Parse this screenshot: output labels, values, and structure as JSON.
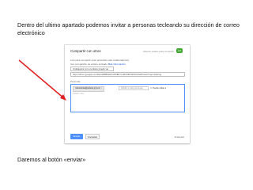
{
  "slide": {
    "intro_text": "Dentro del ultimo apartado podemos invitar a personas tecleando su dirección de correo electrónico",
    "outro_text": "Daremos al botón «enviar»"
  },
  "dialog": {
    "title": "Compartir con otros",
    "top_hint": "Obtener enlace para compartir",
    "top_badge": "GO",
    "link_label": "Link para compartir (solo accesible para colaboradores)",
    "access_label": "Uso compartido de enlace activado",
    "access_link": "Más información",
    "access_select": "Cualquiera con el enlace puede ver",
    "link_url": "https://drive.google.com/file/d/0B8vEOzuPbfEI7xxZDJlWUdSbGlzaFl/view?usp=sharing",
    "people_label": "Personas",
    "chip_email": "milocarrasl@educa.jcyl.es",
    "chip_remove": "×",
    "add_more_placeholder": "Añadir a más personas...",
    "permission": "Puede editar",
    "permission_icon": "pencil-icon",
    "message_placeholder": "Añadir nota",
    "send_button": "Enviar",
    "cancel_button": "Cancelar",
    "advanced": "Avanzado"
  },
  "colors": {
    "send_button": "#4d90fe",
    "badge": "#42a832",
    "arrow": "#e02020"
  }
}
